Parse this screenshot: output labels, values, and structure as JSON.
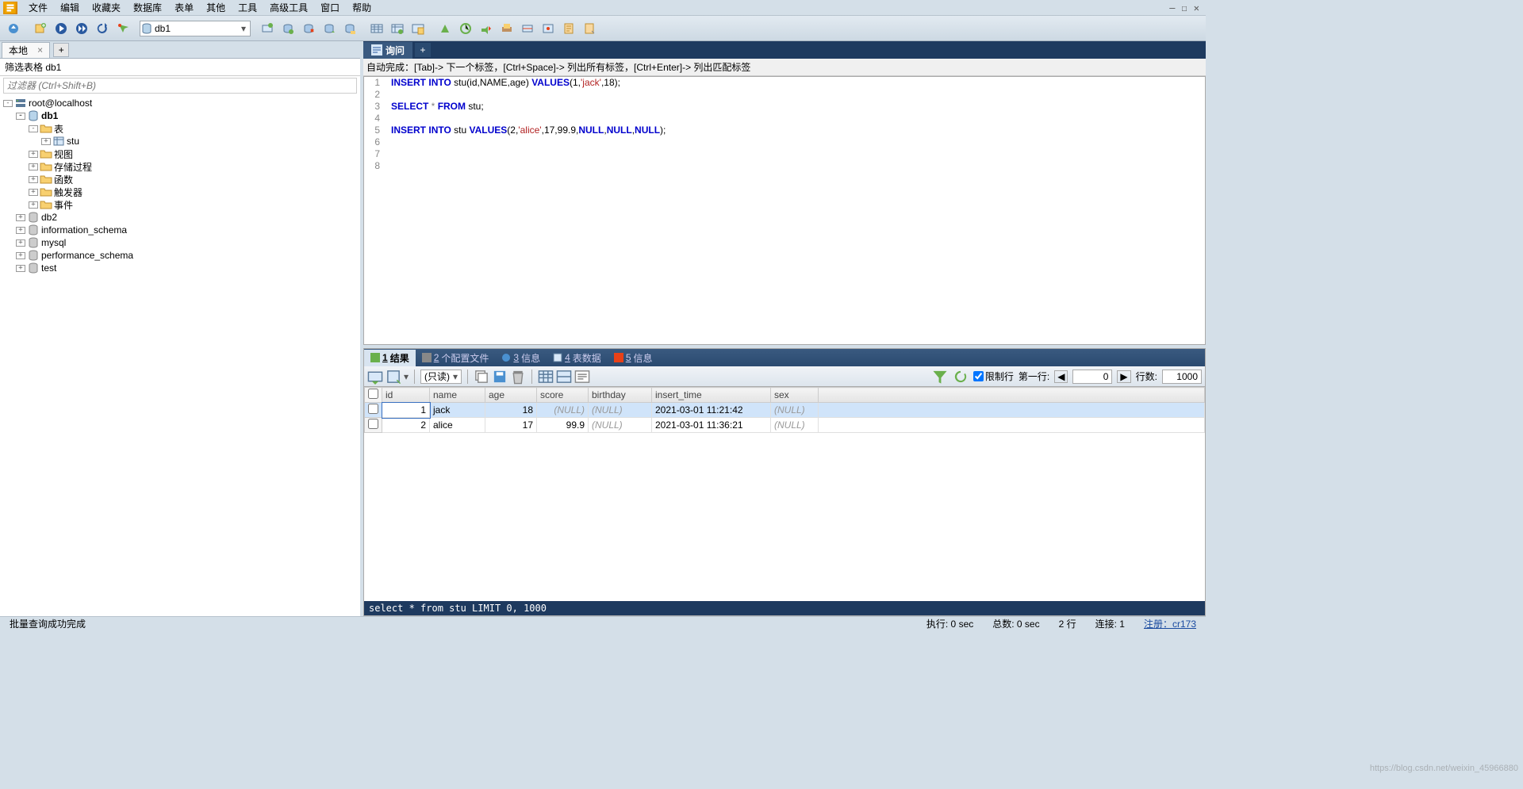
{
  "menu": [
    "文件",
    "编辑",
    "收藏夹",
    "数据库",
    "表单",
    "其他",
    "工具",
    "高级工具",
    "窗口",
    "帮助"
  ],
  "db_selector": "db1",
  "connection_tab": "本地",
  "filter_label": "筛选表格 db1",
  "filter_placeholder": "过滤器 (Ctrl+Shift+B)",
  "tree": {
    "root": "root@localhost",
    "db1": "db1",
    "tables": "表",
    "stu": "stu",
    "views": "视图",
    "procs": "存储过程",
    "funcs": "函数",
    "triggers": "触发器",
    "events": "事件",
    "db2": "db2",
    "infoschema": "information_schema",
    "mysql": "mysql",
    "perfschema": "performance_schema",
    "test": "test"
  },
  "query_tab": "询问",
  "hint": "自动完成：[Tab]-> 下一个标签，[Ctrl+Space]-> 列出所有标签，[Ctrl+Enter]-> 列出匹配标签",
  "code_lines": [
    "1",
    "2",
    "3",
    "4",
    "5",
    "6",
    "7",
    "8"
  ],
  "sql": {
    "l1": {
      "k1": "INSERT",
      "k2": "INTO",
      "t1": " stu(id,NAME,age) ",
      "k3": "VALUES",
      "t2": "(",
      "n1": "1",
      "c1": ",",
      "s1": "'jack'",
      "c2": ",",
      "n2": "18",
      "t3": ");"
    },
    "l3": {
      "k1": "SELECT",
      "star": " * ",
      "k2": "FROM",
      "t1": " stu;"
    },
    "l5": {
      "k1": "INSERT",
      "k2": "INTO",
      "t1": " stu ",
      "k3": "VALUES",
      "t2": "(",
      "n1": "2",
      "c1": ",",
      "s1": "'alice'",
      "c2": ",",
      "n2": "17",
      "c3": ",",
      "n3": "99.9",
      "c4": ",",
      "k4": "NULL",
      "c5": ",",
      "k5": "NULL",
      "c6": ",",
      "k6": "NULL",
      "t3": ");"
    }
  },
  "result_tabs": [
    {
      "num": "1",
      "label": "结果"
    },
    {
      "num": "2",
      "label": "个配置文件",
      "pre": ""
    },
    {
      "num": "3",
      "label": "信息"
    },
    {
      "num": "4",
      "label": "表数据"
    },
    {
      "num": "5",
      "label": "信息"
    }
  ],
  "readonly": "(只读)",
  "limit_label": "限制行",
  "first_row_label": "第一行:",
  "first_row_value": "0",
  "rows_label": "行数:",
  "rows_value": "1000",
  "grid": {
    "cols": [
      "id",
      "name",
      "age",
      "score",
      "birthday",
      "insert_time",
      "sex"
    ],
    "rows": [
      {
        "id": "1",
        "name": "jack",
        "age": "18",
        "score": "(NULL)",
        "birthday": "(NULL)",
        "insert_time": "2021-03-01 11:21:42",
        "sex": "(NULL)"
      },
      {
        "id": "2",
        "name": "alice",
        "age": "17",
        "score": "99.9",
        "birthday": "(NULL)",
        "insert_time": "2021-03-01 11:36:21",
        "sex": "(NULL)"
      }
    ]
  },
  "sql_preview": "select * from stu LIMIT 0, 1000",
  "status": {
    "msg": "批量查询成功完成",
    "exec": "执行: 0 sec",
    "total": "总数: 0 sec",
    "rows": "2 行",
    "conn": "连接: 1",
    "reg": "注册：cr173"
  },
  "watermark": "https://blog.csdn.net/weixin_45966880"
}
